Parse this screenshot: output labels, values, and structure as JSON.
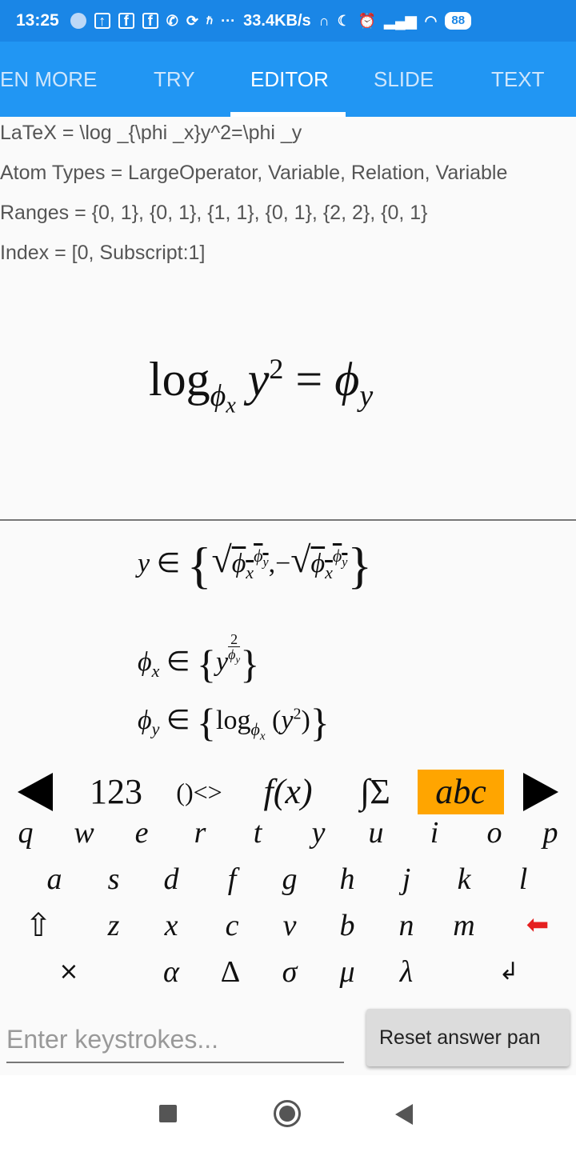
{
  "status_bar": {
    "time": "13:25",
    "network_speed": "33.4KB/s",
    "battery": "88",
    "icons": [
      "app-dot-icon",
      "upload-icon",
      "facebook-icon",
      "facebook-icon",
      "whatsapp-icon",
      "sync-icon",
      "hd-icon",
      "more-dots-icon",
      "headset-icon",
      "moon-icon",
      "alarm-icon",
      "signal-icon",
      "wifi-icon",
      "battery-icon"
    ]
  },
  "tabs": {
    "items": [
      "EN MORE",
      "TRY",
      "EDITOR",
      "SLIDE",
      "TEXT"
    ],
    "active": "EDITOR"
  },
  "info": {
    "latex": "LaTeX = \\log _{\\phi _x}y^2=\\phi _y",
    "atom_types": "Atom Types = LargeOperator, Variable, Relation, Variable",
    "ranges": "Ranges = {0, 1}, {0, 1}, {1, 1}, {0, 1}, {2, 2}, {0, 1}",
    "index": "Index = [0, Subscript:1]"
  },
  "formula": {
    "log": "log",
    "base_var": "ϕ",
    "base_sub": "x",
    "arg": "y",
    "exp": "2",
    "rel": "=",
    "rhs": "ϕ",
    "rhs_sub": "y"
  },
  "solutions": {
    "s1": {
      "var": "y",
      "rel": "∈",
      "l": "{",
      "r": "}",
      "sqrt": "√",
      "phi": "ϕ",
      "sub": "x",
      "sup_phi": "ϕ",
      "sup_sub": "y",
      "comma": ",",
      "minus": "−"
    },
    "s2": {
      "var": "ϕ",
      "sub": "x",
      "rel": "∈",
      "l": "{",
      "r": "}",
      "base": "y",
      "num": "2",
      "den_phi": "ϕ",
      "den_sub": "y"
    },
    "s3": {
      "var": "ϕ",
      "sub": "y",
      "rel": "∈",
      "l": "{",
      "r": "}",
      "log": "log",
      "base_phi": "ϕ",
      "base_sub": "x",
      "lp": "(",
      "y": "y",
      "exp": "2",
      "rp": ")"
    }
  },
  "keyboard": {
    "modes": [
      "123",
      "()<>",
      "f(x)",
      "∫Σ",
      "abc"
    ],
    "selected_mode": "abc",
    "row1": [
      "q",
      "w",
      "e",
      "r",
      "t",
      "y",
      "u",
      "i",
      "o",
      "p"
    ],
    "row2": [
      "a",
      "s",
      "d",
      "f",
      "g",
      "h",
      "j",
      "k",
      "l"
    ],
    "row3": [
      "⇧",
      "z",
      "x",
      "c",
      "v",
      "b",
      "n",
      "m",
      "⬅"
    ],
    "row4": [
      "×",
      "α",
      "Δ",
      "σ",
      "μ",
      "λ",
      "↲"
    ]
  },
  "input": {
    "placeholder": "Enter keystrokes...",
    "value": ""
  },
  "reset_button": "Reset answer pan",
  "colors": {
    "status_bar": "#1a86e6",
    "tab_bar": "#2196f3",
    "selected_mode": "#ffa500",
    "backspace": "#e52020"
  }
}
